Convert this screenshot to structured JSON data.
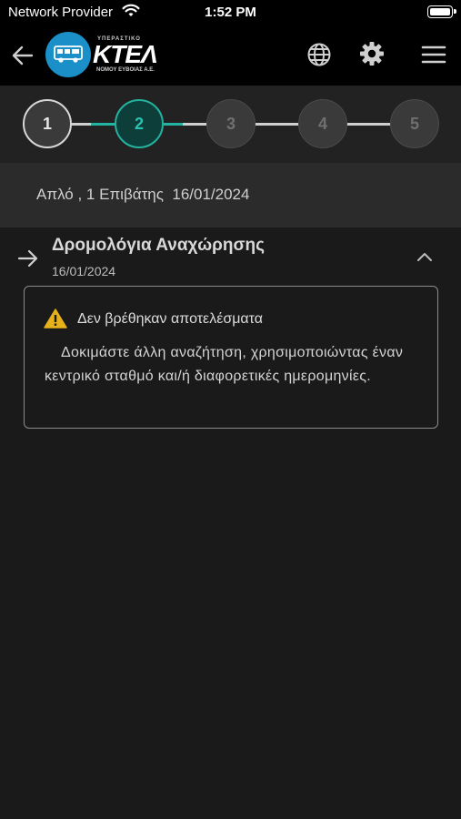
{
  "status_bar": {
    "carrier": "Network Provider",
    "time": "1:52 PM"
  },
  "header": {
    "logo": {
      "brand": "ΚΤΕΛ",
      "tagline_top": "ΥΠΕΡΑΣΤΙΚΟ",
      "tagline_bottom": "ΝΟΜΟΥ ΕΥΒΟΙΑΣ Α.Ε."
    },
    "icons": [
      "back-arrow-icon",
      "globe-icon",
      "gear-icon",
      "hamburger-menu-icon"
    ]
  },
  "stepper": {
    "steps": [
      {
        "label": "1",
        "state": "done"
      },
      {
        "label": "2",
        "state": "active"
      },
      {
        "label": "3",
        "state": "future"
      },
      {
        "label": "4",
        "state": "future"
      },
      {
        "label": "5",
        "state": "future"
      }
    ],
    "active_color": "#23b3a1"
  },
  "summary": {
    "text": "Απλό , 1 Επιβάτης  16/01/2024"
  },
  "section": {
    "title": "Δρομολόγια Αναχώρησης",
    "date": "16/01/2024"
  },
  "result": {
    "title": "Δεν βρέθηκαν αποτελέσματα",
    "body": "Δοκιμάστε άλλη αναζήτηση, χρησιμοποιώντας έναν κεντρικό σταθμό και/ή διαφορετικές ημερομηνίες.",
    "warning_color": "#e6b11a"
  }
}
